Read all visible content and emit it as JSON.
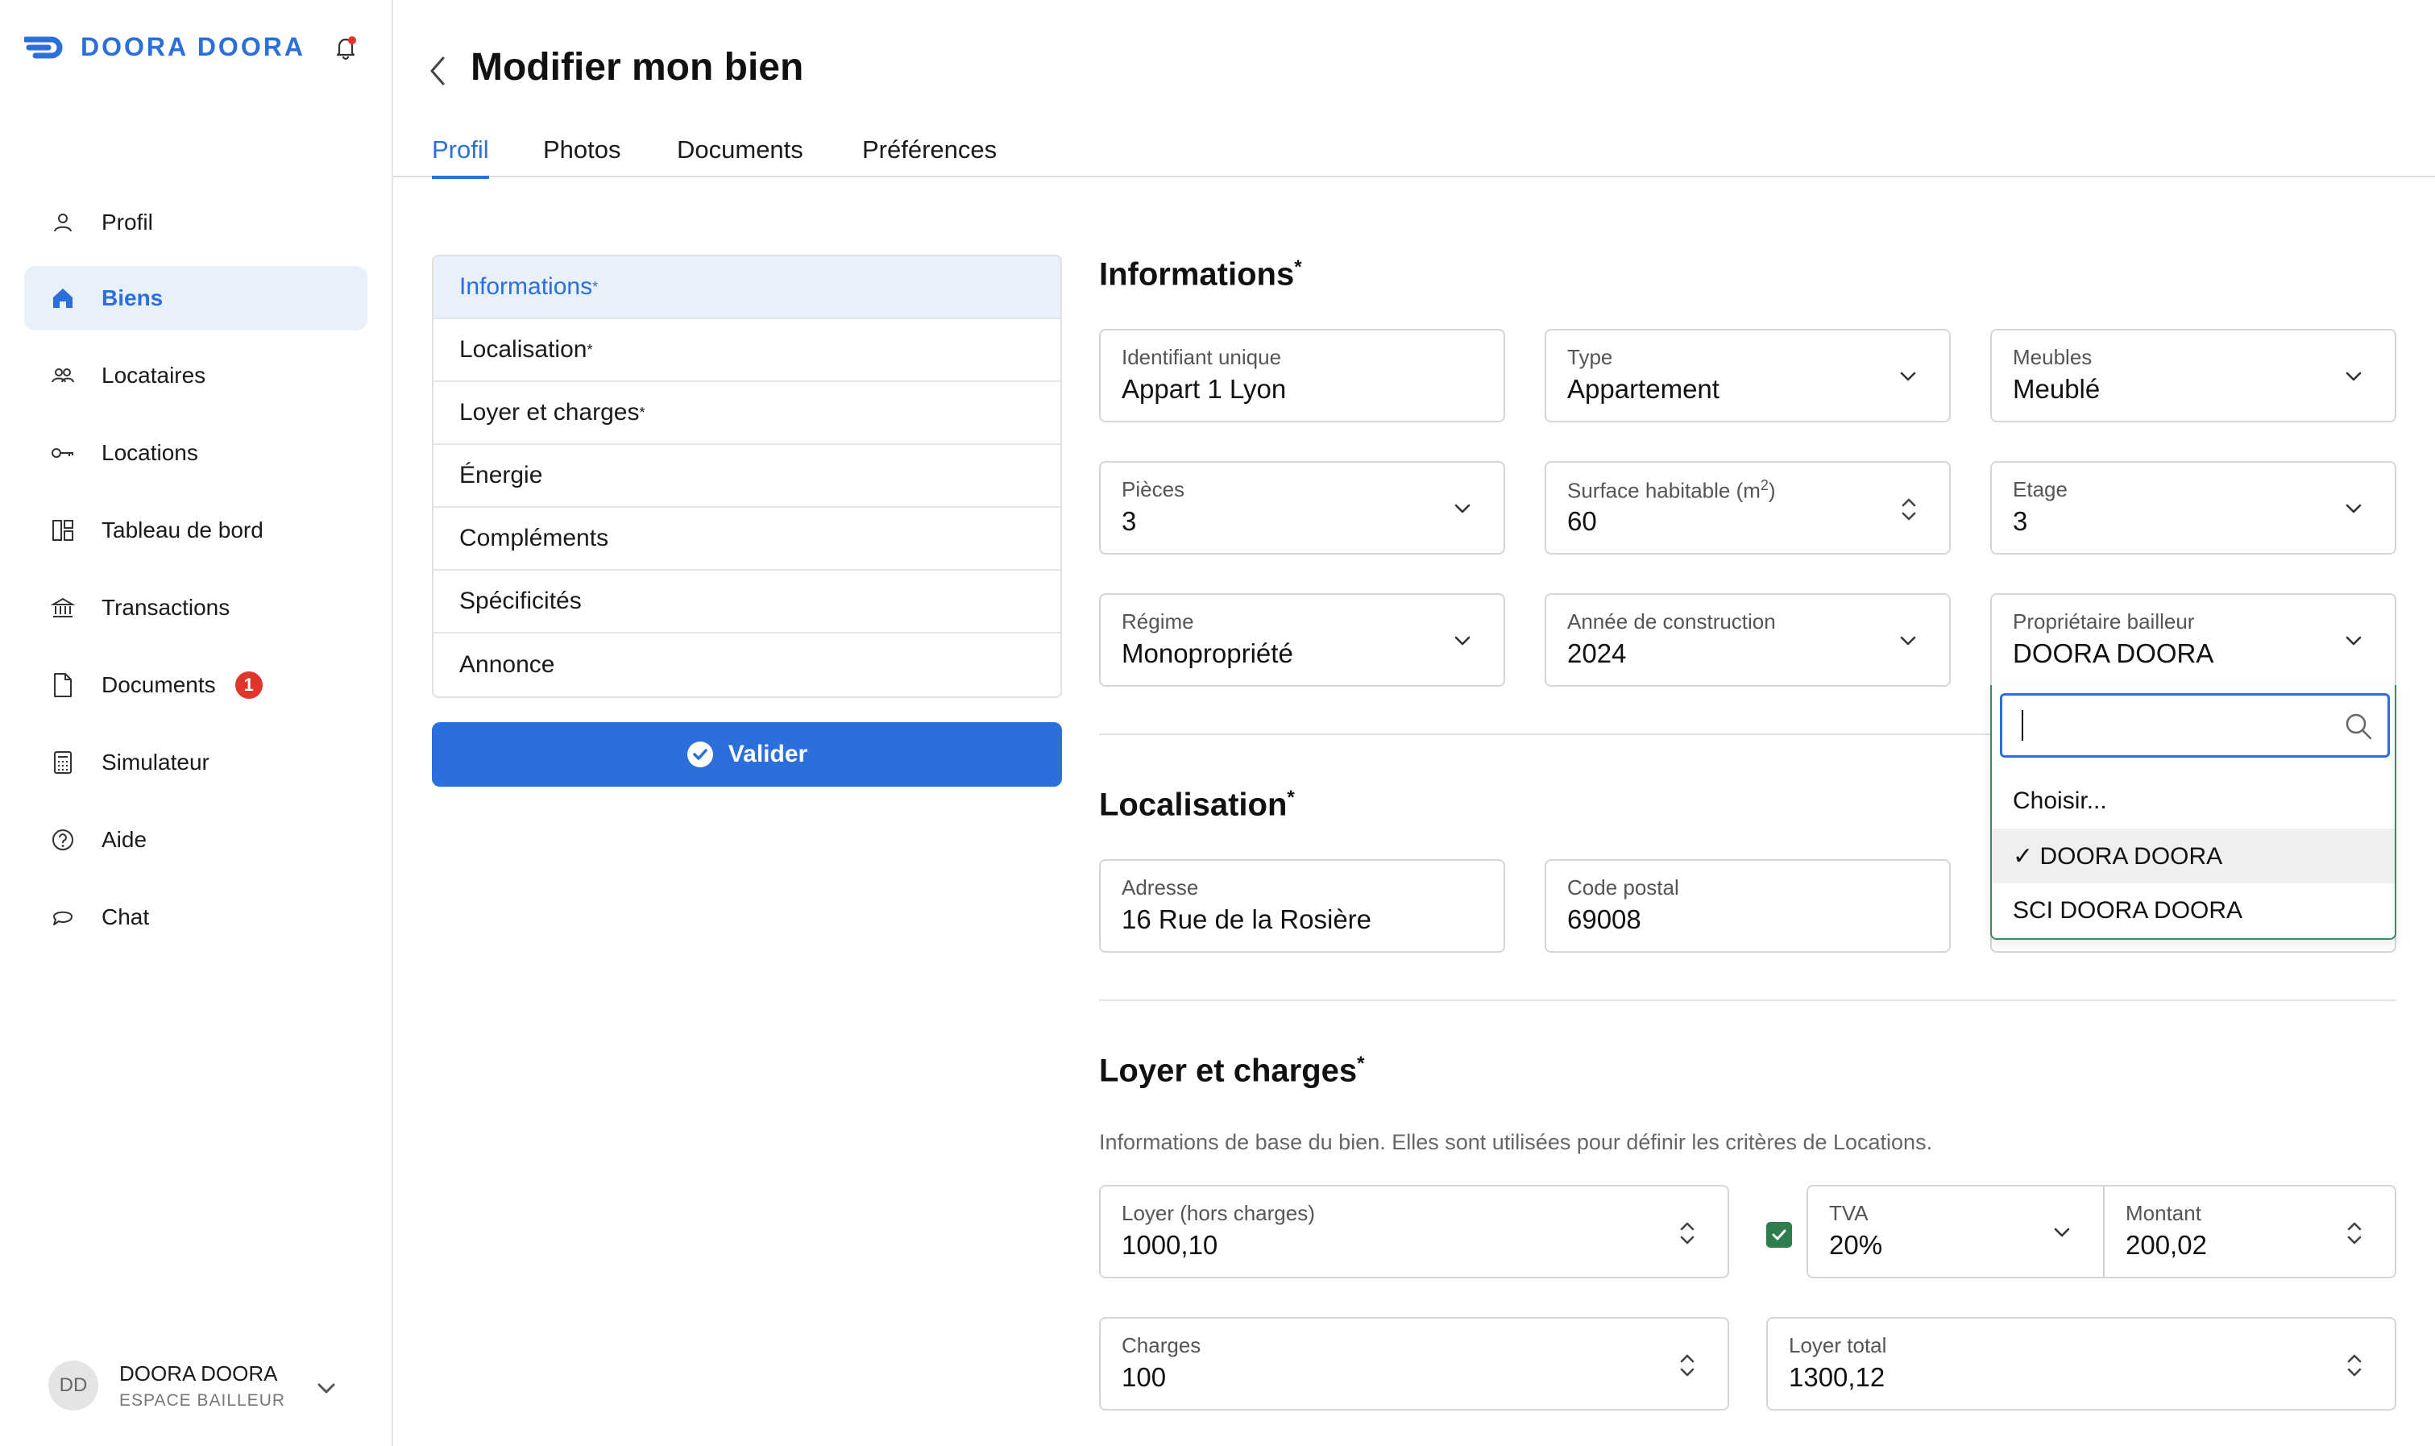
{
  "brand": {
    "name": "DOORA DOORA",
    "color": "#2a6fdb"
  },
  "sidebar": {
    "items": [
      {
        "label": "Profil",
        "icon": "user-icon"
      },
      {
        "label": "Biens",
        "icon": "home-icon",
        "active": true
      },
      {
        "label": "Locataires",
        "icon": "users-icon"
      },
      {
        "label": "Locations",
        "icon": "key-icon"
      },
      {
        "label": "Tableau de bord",
        "icon": "dashboard-icon"
      },
      {
        "label": "Transactions",
        "icon": "bank-icon"
      },
      {
        "label": "Documents",
        "icon": "document-icon",
        "badge": "1"
      },
      {
        "label": "Simulateur",
        "icon": "calculator-icon"
      },
      {
        "label": "Aide",
        "icon": "help-icon"
      },
      {
        "label": "Chat",
        "icon": "chat-icon"
      }
    ],
    "user": {
      "initials": "DD",
      "name": "DOORA DOORA",
      "role": "ESPACE BAILLEUR"
    }
  },
  "header": {
    "title": "Modifier mon bien"
  },
  "tabs": [
    {
      "label": "Profil",
      "active": true
    },
    {
      "label": "Photos"
    },
    {
      "label": "Documents"
    },
    {
      "label": "Préférences"
    }
  ],
  "sections": [
    {
      "label": "Informations",
      "required": "*",
      "active": true
    },
    {
      "label": "Localisation",
      "required": "*"
    },
    {
      "label": "Loyer et charges",
      "required": "*"
    },
    {
      "label": "Énergie",
      "required": ""
    },
    {
      "label": "Compléments",
      "required": ""
    },
    {
      "label": "Spécificités",
      "required": ""
    },
    {
      "label": "Annonce",
      "required": ""
    }
  ],
  "valider_label": "Valider",
  "informations": {
    "title": "Informations",
    "required": "*",
    "fields": {
      "identifiant": {
        "label": "Identifiant unique",
        "value": "Appart 1 Lyon"
      },
      "type": {
        "label": "Type",
        "value": "Appartement"
      },
      "meubles": {
        "label": "Meubles",
        "value": "Meublé"
      },
      "pieces": {
        "label": "Pièces",
        "value": "3"
      },
      "surface": {
        "label": "Surface habitable (m",
        "sup": "2",
        "label_end": ")",
        "value": "60"
      },
      "etage": {
        "label": "Etage",
        "value": "3"
      },
      "regime": {
        "label": "Régime",
        "value": "Monopropriété"
      },
      "annee": {
        "label": "Année de construction",
        "value": "2024"
      },
      "proprietaire": {
        "label": "Propriétaire bailleur",
        "value": "DOORA DOORA"
      }
    }
  },
  "dropdown": {
    "search_value": "",
    "options": [
      {
        "label": "Choisir...",
        "selected": false
      },
      {
        "label": "✓ DOORA DOORA",
        "selected": true
      },
      {
        "label": "SCI DOORA DOORA",
        "selected": false
      }
    ]
  },
  "localisation": {
    "title": "Localisation",
    "required": "*",
    "fields": {
      "adresse": {
        "label": "Adresse",
        "value": "16 Rue de la Rosière"
      },
      "code_postal": {
        "label": "Code postal",
        "value": "69008"
      }
    }
  },
  "loyer": {
    "title": "Loyer et charges",
    "required": "*",
    "description": "Informations de base du bien. Elles sont utilisées pour définir les critères de Locations.",
    "fields": {
      "loyer_hc": {
        "label": "Loyer (hors charges)",
        "value": "1000,10"
      },
      "tva": {
        "label": "TVA",
        "value": "20%",
        "checked": true
      },
      "montant": {
        "label": "Montant",
        "value": "200,02"
      },
      "charges": {
        "label": "Charges",
        "value": "100"
      },
      "loyer_total": {
        "label": "Loyer total",
        "value": "1300,12"
      }
    }
  }
}
